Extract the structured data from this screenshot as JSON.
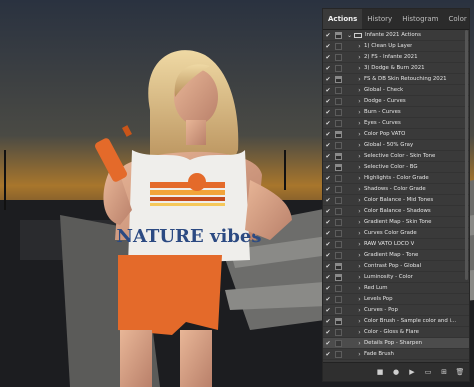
{
  "tabs": [
    "Actions",
    "History",
    "Histogram",
    "Color"
  ],
  "tabs_menu_icon": "menu-icon",
  "actions": [
    {
      "label": "Infante 2021 Actions",
      "folder": true,
      "open": true,
      "dialog": true
    },
    {
      "label": "1) Clean Up Layer",
      "dialog": false
    },
    {
      "label": "2) FS - Infante 2021",
      "dialog": false
    },
    {
      "label": "3) Dodge & Burn 2021",
      "dialog": false
    },
    {
      "label": "FS & DB Skin Retouching 2021",
      "dialog": true
    },
    {
      "label": "Global - Check",
      "dialog": false
    },
    {
      "label": "Dodge - Curves",
      "dialog": false
    },
    {
      "label": "Burn - Curves",
      "dialog": false
    },
    {
      "label": "Eyes - Curves",
      "dialog": false
    },
    {
      "label": "Color Pop VATO",
      "dialog": true
    },
    {
      "label": "Global - 50% Gray",
      "dialog": false
    },
    {
      "label": "Selective Color - Skin Tone",
      "dialog": true
    },
    {
      "label": "Selective Color - BG",
      "dialog": true
    },
    {
      "label": "Highlights - Color Grade",
      "dialog": false
    },
    {
      "label": "Shadows - Color Grade",
      "dialog": false
    },
    {
      "label": "Color Balance - Mid Tones",
      "dialog": false
    },
    {
      "label": "Color Balance - Shadows",
      "dialog": false
    },
    {
      "label": "Gradient Map - Skin Tone",
      "dialog": false
    },
    {
      "label": "Curves Color Grade",
      "dialog": false
    },
    {
      "label": "RAW VATO LOCO V",
      "dialog": false
    },
    {
      "label": "Gradient Map - Tone",
      "dialog": false
    },
    {
      "label": "Contrast Pop - Global",
      "dialog": true
    },
    {
      "label": "Luminosity - Color",
      "dialog": true
    },
    {
      "label": "Red Lum",
      "dialog": false
    },
    {
      "label": "Levels Pop",
      "dialog": false
    },
    {
      "label": "Curves - Pop",
      "dialog": false
    },
    {
      "label": "Color Brush - Sample color and i...",
      "dialog": true
    },
    {
      "label": "Color - Gloss & Flare",
      "dialog": false
    },
    {
      "label": "Details Pop - Sharpen",
      "dialog": false,
      "selected": true
    },
    {
      "label": "Fade Brush",
      "dialog": false
    }
  ],
  "bottom_icons": [
    "stop-icon",
    "record-icon",
    "play-icon",
    "new-set-icon",
    "new-action-icon",
    "delete-icon"
  ],
  "shirt_text": "NATURE vibes",
  "colors": {
    "accent_orange": "#e46a2a",
    "panel_bg": "#3a3a3a"
  }
}
